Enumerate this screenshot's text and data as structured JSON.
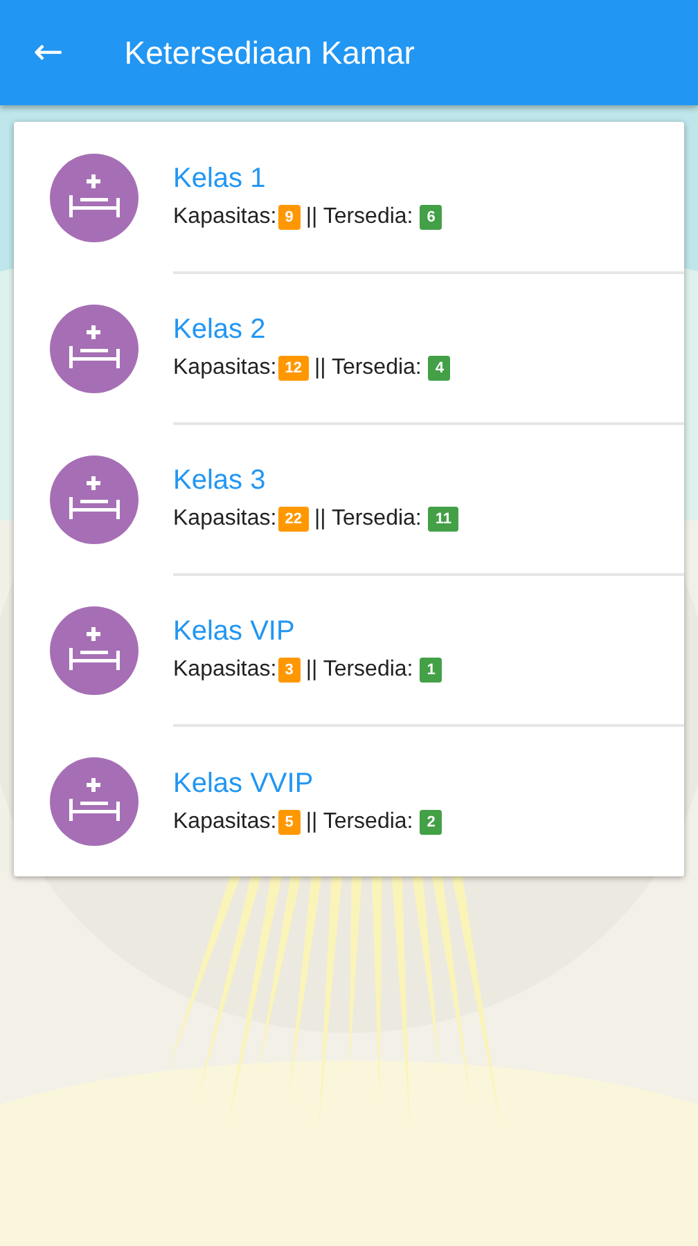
{
  "app_bar": {
    "back": "←",
    "title": "Ketersediaan Kamar"
  },
  "rooms": [
    {
      "name": "Kelas 1",
      "capacity_label": "Kapasitas:",
      "capacity": "9",
      "available_label": "|| Tersedia:",
      "available": "6"
    },
    {
      "name": "Kelas 2",
      "capacity_label": "Kapasitas:",
      "capacity": "12",
      "available_label": "|| Tersedia:",
      "available": "4"
    },
    {
      "name": "Kelas 3",
      "capacity_label": "Kapasitas:",
      "capacity": "22",
      "available_label": "|| Tersedia:",
      "available": "11"
    },
    {
      "name": "Kelas VIP",
      "capacity_label": "Kapasitas:",
      "capacity": "3",
      "available_label": "|| Tersedia:",
      "available": "1"
    },
    {
      "name": "Kelas VVIP",
      "capacity_label": "Kapasitas:",
      "capacity": "5",
      "available_label": "|| Tersedia:",
      "available": "2"
    }
  ]
}
